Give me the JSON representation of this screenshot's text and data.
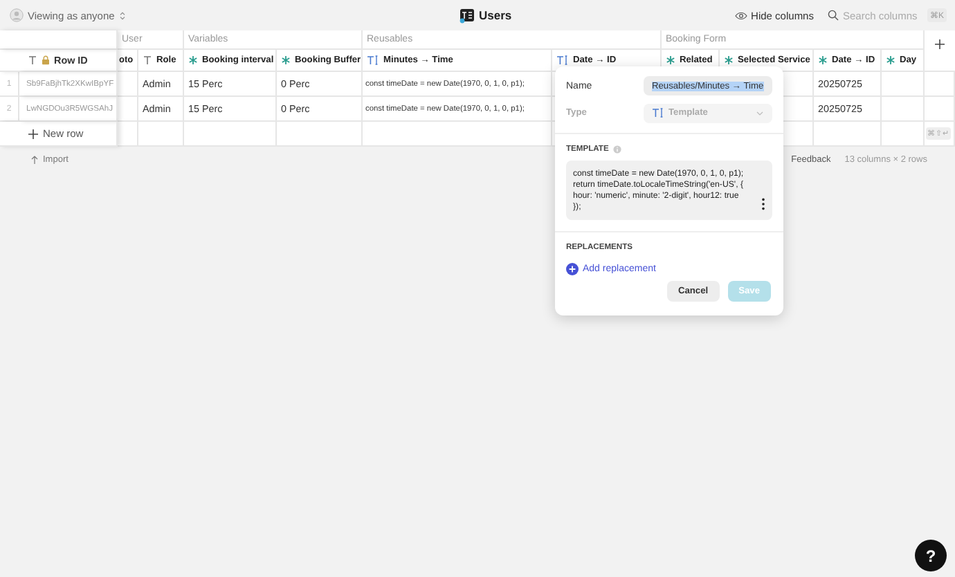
{
  "toolbar": {
    "viewer": "Viewing as anyone",
    "title": "Users",
    "hide_columns": "Hide columns",
    "search": {
      "placeholder": "Search columns"
    },
    "search_shortcut": "⌘K"
  },
  "table": {
    "frozen_column": {
      "label": "Row ID",
      "kind": "text",
      "locked": true
    },
    "groups": [
      {
        "label": "User",
        "columns": [
          {
            "label": "oto",
            "kind": "none",
            "locked": false
          },
          {
            "label": "Role",
            "kind": "text",
            "locked": false
          }
        ]
      },
      {
        "label": "Variables",
        "columns": [
          {
            "label": "Booking interval",
            "kind": "computed",
            "locked": false
          },
          {
            "label": "Booking Buffer",
            "kind": "computed",
            "locked": false
          }
        ]
      },
      {
        "label": "Reusables",
        "columns": [
          {
            "label": "Minutes → Time",
            "kind": "template",
            "locked": false
          },
          {
            "label": "Date → ID",
            "kind": "template",
            "locked": false
          }
        ]
      },
      {
        "label": "Booking Form",
        "columns": [
          {
            "label": "Related",
            "kind": "computed",
            "locked": false
          },
          {
            "label": "Selected Service",
            "kind": "computed",
            "locked": false
          },
          {
            "label": "Date → ID",
            "kind": "computed",
            "locked": false
          },
          {
            "label": "Day",
            "kind": "computed",
            "locked": false
          }
        ]
      }
    ],
    "rows": [
      {
        "number": "1",
        "cells": [
          "Sb9FaBjhTk2XKwIBpYF",
          null,
          "Admin",
          "15 Perc",
          "0 Perc",
          "const timeDate = new Date(1970, 0, 1, 0, p1);",
          null,
          null,
          null,
          "20250725",
          null
        ]
      },
      {
        "number": "2",
        "cells": [
          "LwNGDOu3R5WGSAhJ",
          null,
          "Admin",
          "15 Perc",
          "0 Perc",
          "const timeDate = new Date(1970, 0, 1, 0, p1);",
          null,
          null,
          null,
          "20250725",
          null
        ]
      }
    ],
    "new_row": "New row",
    "new_row_shortcut": "⌘⇧↵"
  },
  "footer": {
    "import": "Import",
    "feedback": "Feedback",
    "summary": "13 columns × 2 rows"
  },
  "editor": {
    "name_label": "Name",
    "name_value": "Reusables/Minutes → Time",
    "name_selected": true,
    "type_label": "Type",
    "type_value": "Template",
    "type_disabled": true,
    "template_heading": "TEMPLATE",
    "template_code": "const timeDate = new Date(1970, 0, 1, 0, p1);\nreturn timeDate.toLocaleTimeString('en-US', {\nhour: 'numeric', minute: '2-digit', hour12: true\n});",
    "replacements_heading": "REPLACEMENTS",
    "add_replacement": "Add replacement",
    "buttons": [
      {
        "label": "Cancel",
        "kind": "secondary",
        "disabled": false
      },
      {
        "label": "Save",
        "kind": "primary",
        "disabled": true
      }
    ]
  },
  "help": "?"
}
